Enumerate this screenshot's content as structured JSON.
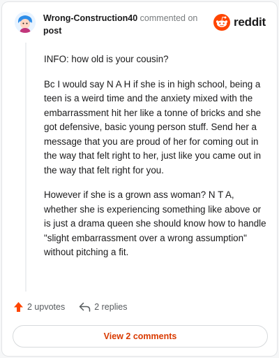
{
  "comment": {
    "author": "Wrong-Construction40",
    "action_text": "commented on",
    "post_link": "post",
    "paragraphs": [
      "INFO: how old is your cousin?",
      "Bc I would say N A H if she is in high school, being a teen is a weird time and the anxiety mixed with the embarrassment hit her like a tonne of bricks and she got defensive, basic young person stuff. Send her a message that you are proud of her for coming out in the way that felt right to her, just like you came out in the way that felt right for you.",
      "However if she is a grown ass woman? N T A, whether she is experiencing something like above or is just a drama queen she should know how to handle \"slight embarrassment over a wrong assumption\" without pitching a fit."
    ],
    "upvotes": "2 upvotes",
    "replies": "2 replies"
  },
  "brand": {
    "name": "reddit",
    "color": "#ff4500"
  },
  "footer": {
    "view_comments": "View 2 comments"
  },
  "colors": {
    "accent": "#d93a00",
    "upvote": "#ff4500"
  },
  "icons": {
    "avatar": "snoo-avatar-icon",
    "brand": "reddit-logo-icon",
    "upvote": "upvote-arrow-icon",
    "reply": "reply-arrow-icon"
  }
}
